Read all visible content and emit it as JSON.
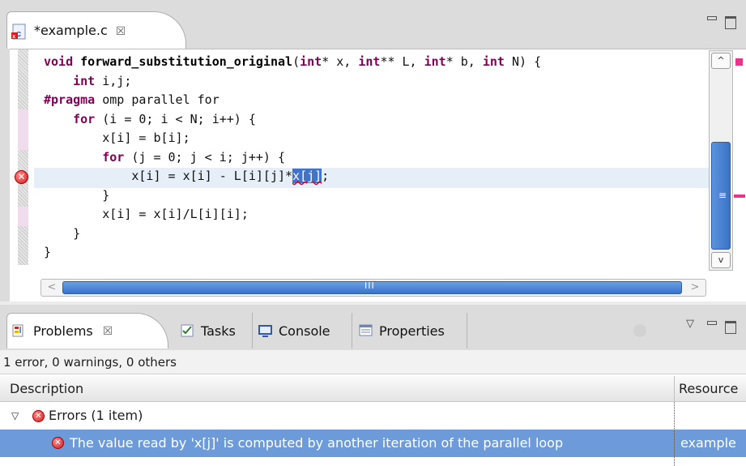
{
  "editor": {
    "tab_title": "*example.c",
    "tab_close": "☒",
    "file_icon": "c-source-file-icon",
    "lines": [
      {
        "parts": [
          [
            "kw",
            "void "
          ],
          [
            "fn",
            "forward_substitution_original"
          ],
          [
            "",
            "("
          ],
          [
            "kw",
            "int"
          ],
          [
            "",
            "* x, "
          ],
          [
            "kw",
            "int"
          ],
          [
            "",
            "** L, "
          ],
          [
            "kw",
            "int"
          ],
          [
            "",
            "* b, "
          ],
          [
            "kw",
            "int"
          ],
          [
            "",
            " N) {"
          ]
        ]
      },
      {
        "parts": [
          [
            "",
            "    "
          ],
          [
            "kw",
            "int"
          ],
          [
            "",
            " i,j;"
          ]
        ]
      },
      {
        "parts": [
          [
            "kw",
            "#pragma"
          ],
          [
            "",
            " omp parallel for"
          ]
        ]
      },
      {
        "parts": [
          [
            "",
            "    "
          ],
          [
            "kw",
            "for"
          ],
          [
            "",
            " (i = 0; i < N; i++) {"
          ]
        ]
      },
      {
        "parts": [
          [
            "",
            "        x[i] = b[i];"
          ]
        ]
      },
      {
        "parts": [
          [
            "",
            "        "
          ],
          [
            "kw",
            "for"
          ],
          [
            "",
            " (j = 0; j < i; j++) {"
          ]
        ]
      },
      {
        "parts": [
          [
            "",
            "            x[i] = x[i] - L[i][j]*"
          ],
          [
            "sel",
            "x[j]"
          ],
          [
            "",
            ";"
          ]
        ]
      },
      {
        "parts": [
          [
            "",
            "        }"
          ]
        ]
      },
      {
        "parts": [
          [
            "",
            "        x[i] = x[i]/L[i][i];"
          ]
        ]
      },
      {
        "parts": [
          [
            "",
            "    }"
          ]
        ]
      },
      {
        "parts": [
          [
            "",
            "}"
          ]
        ]
      }
    ],
    "error_marker_line": 7,
    "vscroll_grip": "≡",
    "hscroll_grip": "III",
    "scroll_up": "^",
    "scroll_down": "v",
    "scroll_left": "<",
    "scroll_right": ">"
  },
  "problems_panel": {
    "tabs": [
      {
        "label": "Problems",
        "close": "☒",
        "icon": "problems-icon"
      },
      {
        "label": "Tasks",
        "icon": "tasks-icon"
      },
      {
        "label": "Console",
        "icon": "console-icon"
      },
      {
        "label": "Properties",
        "icon": "properties-icon"
      }
    ],
    "summary": "1 error, 0 warnings, 0 others",
    "columns": [
      "Description",
      "Resource"
    ],
    "group": {
      "label": "Errors (1 item)",
      "expanded": true
    },
    "items": [
      {
        "description": "The value read by 'x[j]' is computed by another iteration of the parallel loop",
        "resource": "example"
      }
    ],
    "colors": {
      "selected_row": "#6d9ad8",
      "error": "#d21c1c",
      "keyword": "#7f0055"
    }
  }
}
